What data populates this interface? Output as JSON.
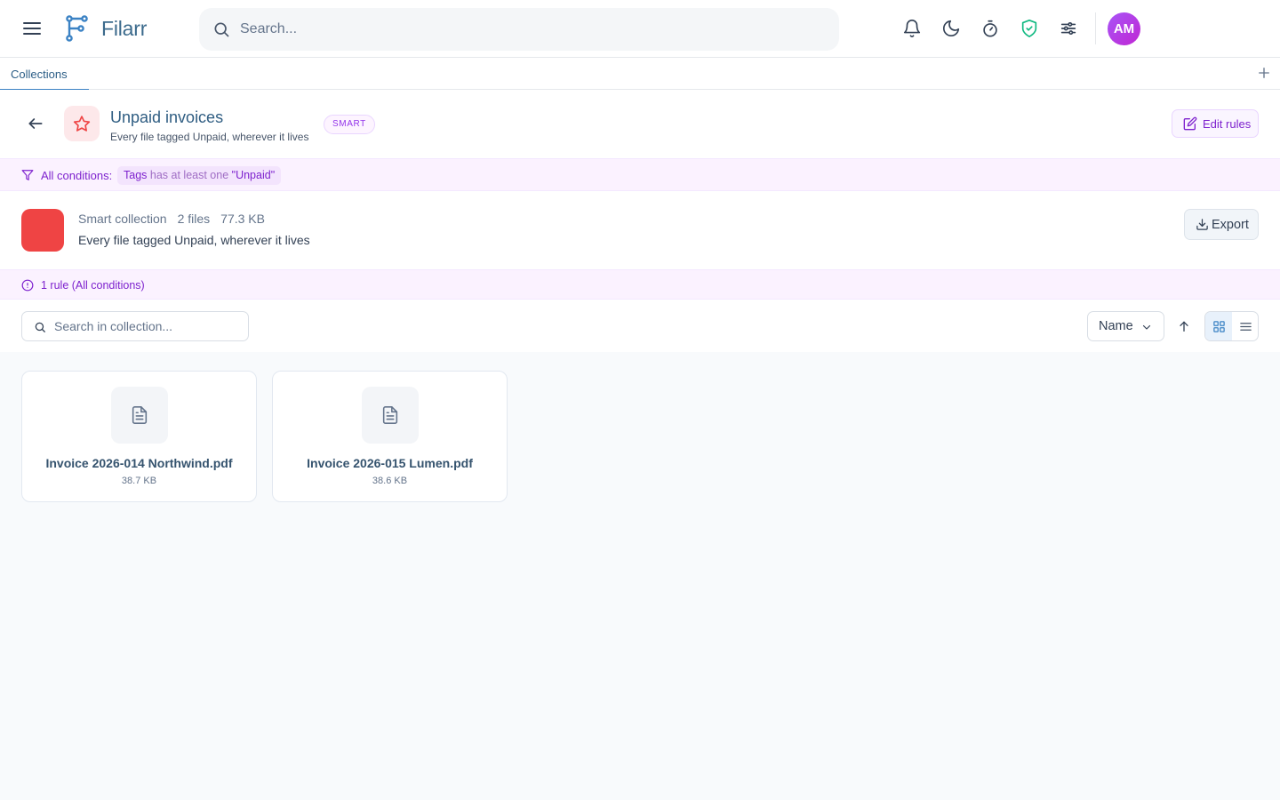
{
  "app": {
    "brand": "Filarr",
    "search_placeholder": "Search...",
    "avatar_initials": "AM",
    "accent_color": "#3b82c4"
  },
  "top_icons": [
    "bell-icon",
    "moon-icon",
    "timer-icon",
    "shield-check-icon",
    "sliders-icon"
  ],
  "tabs": [
    {
      "label": "Collections",
      "active": true
    }
  ],
  "collection": {
    "title": "Unpaid invoices",
    "subtitle": "Every file tagged Unpaid, wherever it lives",
    "badge": "SMART",
    "edit_label": "Edit rules",
    "color": "#ef4444"
  },
  "conditions": {
    "label": "All conditions:",
    "chip_field": "Tags",
    "chip_operator": "has at least one",
    "chip_value": "\"Unpaid\""
  },
  "info": {
    "type": "Smart collection",
    "count": "2 files",
    "size": "77.3 KB",
    "description": "Every file tagged Unpaid, wherever it lives",
    "export_label": "Export"
  },
  "rules_summary": "1 rule (All conditions)",
  "toolbar": {
    "search_placeholder": "Search in collection...",
    "sort_label": "Name",
    "view_mode": "grid"
  },
  "files": [
    {
      "name": "Invoice 2026-014 Northwind.pdf",
      "size": "38.7 KB"
    },
    {
      "name": "Invoice 2026-015 Lumen.pdf",
      "size": "38.6 KB"
    }
  ]
}
